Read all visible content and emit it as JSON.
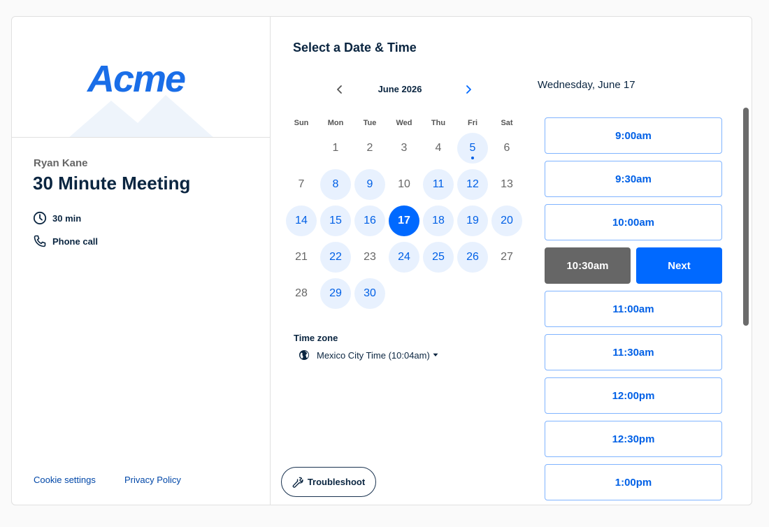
{
  "brand": {
    "logo_text": "Acme",
    "accent": "#0069ff",
    "logo_color": "#1a6ee8"
  },
  "event": {
    "host": "Ryan Kane",
    "title": "30 Minute Meeting",
    "duration": "30 min",
    "duration_icon": "clock-icon",
    "location": "Phone call",
    "location_icon": "phone-icon"
  },
  "footer": {
    "cookie": "Cookie settings",
    "privacy": "Privacy Policy"
  },
  "scheduler": {
    "title": "Select a Date & Time",
    "month": "June 2026",
    "weekdays": [
      "Sun",
      "Mon",
      "Tue",
      "Wed",
      "Thu",
      "Fri",
      "Sat"
    ],
    "days": [
      {
        "d": "1",
        "state": "off"
      },
      {
        "d": "2",
        "state": "off"
      },
      {
        "d": "3",
        "state": "off"
      },
      {
        "d": "4",
        "state": "off"
      },
      {
        "d": "5",
        "state": "avail",
        "today": true
      },
      {
        "d": "6",
        "state": "off"
      },
      {
        "d": "7",
        "state": "off"
      },
      {
        "d": "8",
        "state": "avail"
      },
      {
        "d": "9",
        "state": "avail"
      },
      {
        "d": "10",
        "state": "off"
      },
      {
        "d": "11",
        "state": "avail"
      },
      {
        "d": "12",
        "state": "avail"
      },
      {
        "d": "13",
        "state": "off"
      },
      {
        "d": "14",
        "state": "avail"
      },
      {
        "d": "15",
        "state": "avail"
      },
      {
        "d": "16",
        "state": "avail"
      },
      {
        "d": "17",
        "state": "selected"
      },
      {
        "d": "18",
        "state": "avail"
      },
      {
        "d": "19",
        "state": "avail"
      },
      {
        "d": "20",
        "state": "avail"
      },
      {
        "d": "21",
        "state": "off"
      },
      {
        "d": "22",
        "state": "avail"
      },
      {
        "d": "23",
        "state": "off"
      },
      {
        "d": "24",
        "state": "avail"
      },
      {
        "d": "25",
        "state": "avail"
      },
      {
        "d": "26",
        "state": "avail"
      },
      {
        "d": "27",
        "state": "off"
      },
      {
        "d": "28",
        "state": "off"
      },
      {
        "d": "29",
        "state": "avail"
      },
      {
        "d": "30",
        "state": "avail"
      }
    ],
    "first_weekday": 1,
    "timezone_label": "Time zone",
    "timezone_value": "Mexico City Time (10:04am)",
    "troubleshoot": "Troubleshoot"
  },
  "times": {
    "date_heading": "Wednesday, June 17",
    "slots": [
      "9:00am",
      "9:30am",
      "10:00am",
      "10:30am",
      "11:00am",
      "11:30am",
      "12:00pm",
      "12:30pm",
      "1:00pm"
    ],
    "selected_index": 3,
    "selected_label": "10:30am",
    "next_label": "Next"
  }
}
